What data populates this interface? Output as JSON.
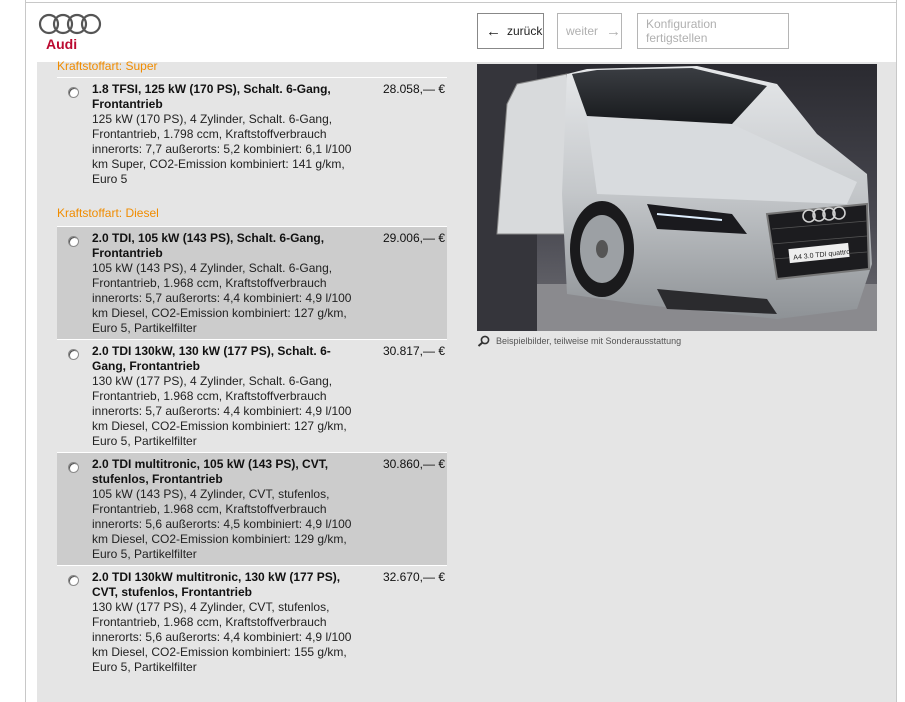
{
  "header": {
    "brand": "Audi",
    "back_label": "zurück",
    "next_label": "weiter",
    "finish_label": "Konfiguration fertigstellen",
    "back_icon": "←",
    "next_icon": "→"
  },
  "colors": {
    "accent": "#f08c00",
    "brand": "#bb0a30",
    "panel": "#e5e5e5",
    "row_shaded": "#cccccc"
  },
  "categories": {
    "super": "Kraftstoffart: Super",
    "diesel": "Kraftstoffart: Diesel"
  },
  "engines_super": [
    {
      "title": "1.8 TFSI, 125 kW (170 PS), Schalt. 6-Gang, Frontantrieb",
      "desc": "125 kW (170 PS), 4 Zylinder, Schalt. 6-Gang, Frontantrieb, 1.798 ccm, Kraftstoffverbrauch innerorts: 7,7 außerorts: 5,2 kombiniert: 6,1 l/100 km Super, CO2-Emission kombiniert: 141 g/km, Euro 5",
      "price": "28.058,— €"
    }
  ],
  "engines_diesel": [
    {
      "title": "2.0 TDI, 105 kW (143 PS), Schalt. 6-Gang, Frontantrieb",
      "desc": "105 kW (143 PS), 4 Zylinder, Schalt. 6-Gang, Frontantrieb, 1.968 ccm, Kraftstoffverbrauch innerorts: 5,7 außerorts: 4,4 kombiniert: 4,9 l/100 km Diesel, CO2-Emission kombiniert: 127 g/km, Euro 5, Partikelfilter",
      "price": "29.006,— €"
    },
    {
      "title": "2.0 TDI 130kW, 130 kW (177 PS), Schalt. 6-Gang, Frontantrieb",
      "desc": "130 kW (177 PS), 4 Zylinder, Schalt. 6-Gang, Frontantrieb, 1.968 ccm, Kraftstoffverbrauch innerorts: 5,7 außerorts: 4,4 kombiniert: 4,9 l/100 km Diesel, CO2-Emission kombiniert: 127 g/km, Euro 5, Partikelfilter",
      "price": "30.817,— €"
    },
    {
      "title": "2.0 TDI multitronic, 105 kW (143 PS), CVT, stufenlos, Frontantrieb",
      "desc": "105 kW (143 PS), 4 Zylinder, CVT, stufenlos, Frontantrieb, 1.968 ccm, Kraftstoffverbrauch innerorts: 5,6 außerorts: 4,5 kombiniert: 4,9 l/100 km Diesel, CO2-Emission kombiniert: 129 g/km, Euro 5, Partikelfilter",
      "price": "30.860,— €"
    },
    {
      "title": "2.0 TDI 130kW multitronic, 130 kW (177 PS), CVT, stufenlos, Frontantrieb",
      "desc": "130 kW (177 PS), 4 Zylinder, CVT, stufenlos, Frontantrieb, 1.968 ccm, Kraftstoffverbrauch innerorts: 5,6 außerorts: 4,4 kombiniert: 4,9 l/100 km Diesel, CO2-Emission kombiniert: 155 g/km, Euro 5, Partikelfilter",
      "price": "32.670,— €"
    }
  ],
  "photo": {
    "plate": "A4 3.0 TDI quattro",
    "caption": "Beispielbilder, teilweise mit Sonderausstattung"
  }
}
